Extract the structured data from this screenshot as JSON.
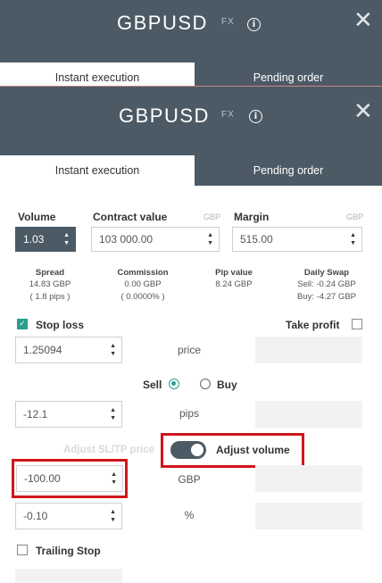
{
  "header": {
    "symbol": "GBPUSD",
    "fx_badge": "FX",
    "info_icon": "i",
    "close_icon": "✕"
  },
  "tabs": [
    {
      "label": "Instant execution"
    },
    {
      "label": "Pending order"
    }
  ],
  "volume": {
    "label": "Volume",
    "value": "1.03"
  },
  "contract_value": {
    "label": "Contract value",
    "currency": "GBP",
    "value": "103 000.00"
  },
  "margin": {
    "label": "Margin",
    "currency": "GBP",
    "value": "515.00"
  },
  "stats": {
    "spread": {
      "title": "Spread",
      "line1": "14.83 GBP",
      "line2": "( 1.8 pips )"
    },
    "commission": {
      "title": "Commission",
      "line1": "0.00 GBP",
      "line2": "( 0.0000% )"
    },
    "pip_value": {
      "title": "Pip value",
      "line1": "8.24 GBP"
    },
    "daily_swap": {
      "title": "Daily Swap",
      "line1": "Sell: -0.24 GBP",
      "line2": "Buy: -4.27 GBP"
    }
  },
  "stop_loss": {
    "label": "Stop loss",
    "checked": true
  },
  "take_profit": {
    "label": "Take profit",
    "checked": false
  },
  "rows": {
    "price": {
      "sl_value": "1.25094",
      "label": "price"
    },
    "pips": {
      "sl_value": "-12.1",
      "label": "pips"
    },
    "gbp": {
      "sl_value": "-100.00",
      "label": "GBP"
    },
    "percent": {
      "sl_value": "-0.10",
      "label": "%"
    }
  },
  "side": {
    "sell_label": "Sell",
    "buy_label": "Buy",
    "selected": "Sell"
  },
  "adjust": {
    "sltp_label": "Adjust SL/TP price",
    "volume_label": "Adjust volume"
  },
  "trailing_stop": {
    "label": "Trailing Stop",
    "checked": false
  },
  "colors": {
    "header": "#4b5a65",
    "accent": "#2a9d8f",
    "highlight": "#d0161b"
  }
}
